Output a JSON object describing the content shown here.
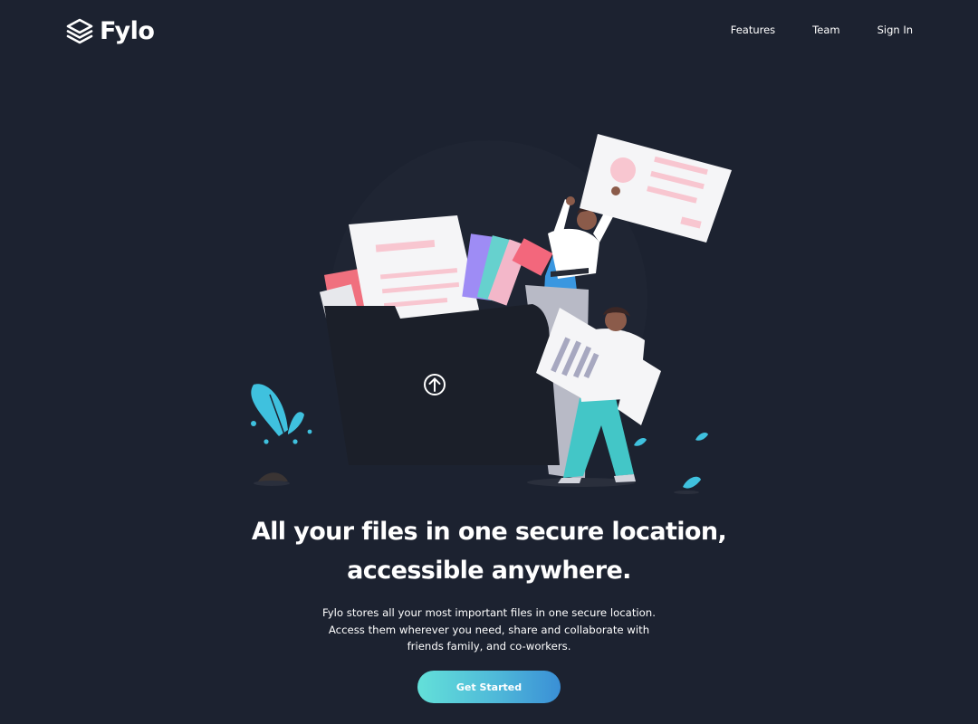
{
  "header": {
    "logo_text": "Fylo",
    "nav": [
      {
        "label": "Features"
      },
      {
        "label": "Team"
      },
      {
        "label": "Sign In"
      }
    ]
  },
  "hero": {
    "title_line1": "All your files in one secure location,",
    "title_line2": "accessible anywhere.",
    "description_line1": "Fylo stores all your most important files in one secure location.",
    "description_line2": "Access them wherever you need, share and collaborate with",
    "description_line3": "friends family, and co-workers.",
    "cta_label": "Get Started",
    "illustration_icon": "upload-arrow-icon"
  },
  "colors": {
    "background": "#1c2230",
    "folder": "#1b1f29",
    "accent_cyan": "#63e0d9",
    "accent_blue": "#3a8fd6",
    "paper_pink": "#f8c6d0"
  }
}
